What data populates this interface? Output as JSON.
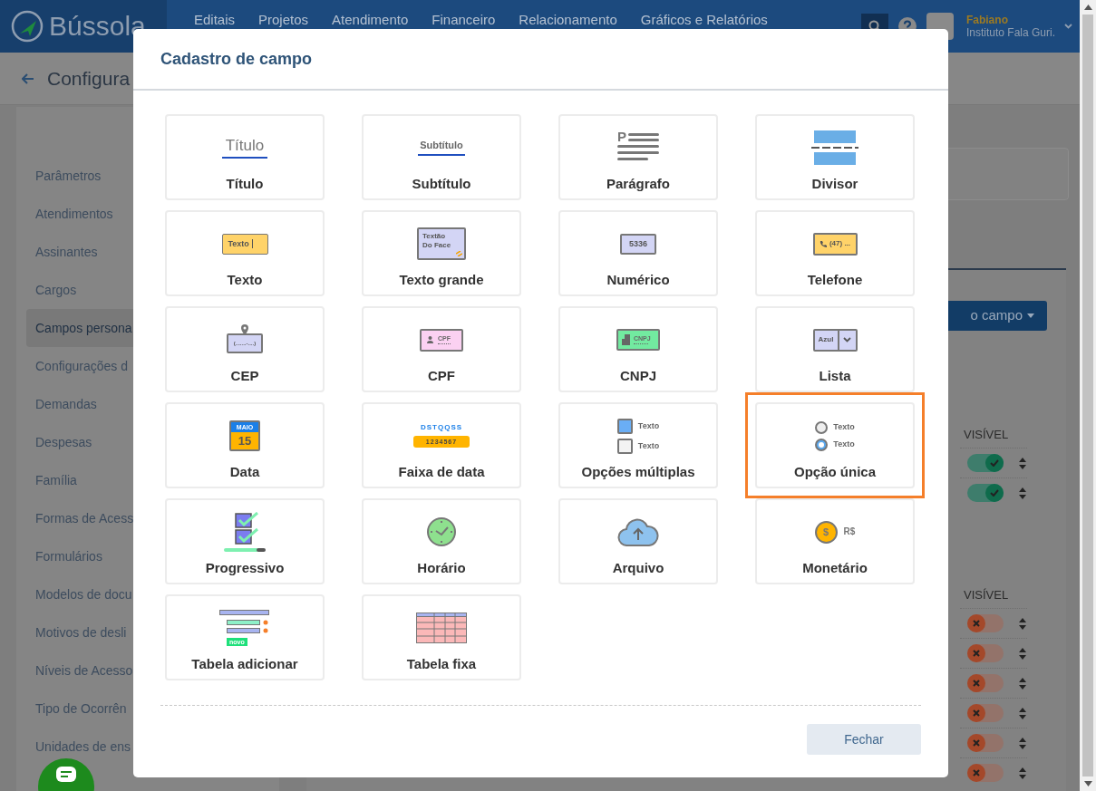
{
  "header": {
    "logo": "Bússola",
    "nav": [
      "Editais",
      "Projetos",
      "Atendimento",
      "Financeiro",
      "Relacionamento",
      "Gráficos e Relatórios"
    ],
    "user_name": "Fabiano",
    "user_org": "Instituto Fala Guri."
  },
  "page_title": "Configura",
  "sidebar": {
    "items": [
      {
        "label": "Parâmetros",
        "selected": false
      },
      {
        "label": "Atendimentos",
        "selected": false
      },
      {
        "label": "Assinantes",
        "selected": false
      },
      {
        "label": "Cargos",
        "selected": false
      },
      {
        "label": "Campos persona",
        "selected": true
      },
      {
        "label": "Configurações d",
        "selected": false
      },
      {
        "label": "Demandas",
        "selected": false
      },
      {
        "label": "Despesas",
        "selected": false
      },
      {
        "label": "Família",
        "selected": false
      },
      {
        "label": "Formas de Acess",
        "selected": false
      },
      {
        "label": "Formulários",
        "selected": false
      },
      {
        "label": "Modelos de docu",
        "selected": false
      },
      {
        "label": "Motivos de desli",
        "selected": false
      },
      {
        "label": "Níveis de Acesso",
        "selected": false
      },
      {
        "label": "Tipo de Ocorrên",
        "selected": false
      },
      {
        "label": "Unidades de ens",
        "selected": false
      }
    ]
  },
  "add_button": "o campo",
  "visible_tables": [
    {
      "header": "VISÍVEL",
      "rows": [
        {
          "on": true
        },
        {
          "on": true
        }
      ]
    },
    {
      "header": "VISÍVEL",
      "rows": [
        {
          "on": false
        },
        {
          "on": false
        },
        {
          "on": false
        },
        {
          "on": false
        },
        {
          "on": false
        },
        {
          "on": false
        }
      ]
    }
  ],
  "modal": {
    "title": "Cadastro de campo",
    "close_button": "Fechar",
    "fields": [
      {
        "kind": "title",
        "label": "Título",
        "icon_texts": [
          "Título"
        ],
        "selected": false
      },
      {
        "kind": "subtitle",
        "label": "Subtítulo",
        "icon_texts": [
          "Subtítulo"
        ],
        "selected": false
      },
      {
        "kind": "paragraph",
        "label": "Parágrafo",
        "icon_texts": [
          "P"
        ],
        "selected": false
      },
      {
        "kind": "divider",
        "label": "Divisor",
        "selected": false
      },
      {
        "kind": "text",
        "label": "Texto",
        "icon_texts": [
          "Texto"
        ],
        "selected": false
      },
      {
        "kind": "textarea",
        "label": "Texto grande",
        "icon_texts": [
          "Textão",
          "Do Face"
        ],
        "selected": false
      },
      {
        "kind": "number",
        "label": "Numérico",
        "icon_texts": [
          "5336"
        ],
        "selected": false
      },
      {
        "kind": "phone",
        "label": "Telefone",
        "icon_texts": [
          "(47) ..."
        ],
        "selected": false
      },
      {
        "kind": "cep",
        "label": "CEP",
        "icon_texts": [
          "(.......-....)"
        ],
        "selected": false
      },
      {
        "kind": "cpf",
        "label": "CPF",
        "icon_texts": [
          "CPF"
        ],
        "selected": false
      },
      {
        "kind": "cnpj",
        "label": "CNPJ",
        "icon_texts": [
          "CNPJ"
        ],
        "selected": false
      },
      {
        "kind": "list",
        "label": "Lista",
        "icon_texts": [
          "Azul"
        ],
        "selected": false
      },
      {
        "kind": "date",
        "label": "Data",
        "icon_texts": [
          "MAIO",
          "15"
        ],
        "selected": false
      },
      {
        "kind": "daterange",
        "label": "Faixa de data",
        "icon_texts": [
          "DSTQQSS",
          "1234567"
        ],
        "selected": false
      },
      {
        "kind": "multi",
        "label": "Opções múltiplas",
        "icon_texts": [
          "Texto",
          "Texto"
        ],
        "selected": false
      },
      {
        "kind": "single",
        "label": "Opção única",
        "icon_texts": [
          "Texto",
          "Texto"
        ],
        "selected": true
      },
      {
        "kind": "progressive",
        "label": "Progressivo",
        "selected": false
      },
      {
        "kind": "time",
        "label": "Horário",
        "selected": false
      },
      {
        "kind": "file",
        "label": "Arquivo",
        "selected": false
      },
      {
        "kind": "money",
        "label": "Monetário",
        "icon_texts": [
          "$",
          "R$"
        ],
        "selected": false
      },
      {
        "kind": "addtable",
        "label": "Tabela adicionar",
        "icon_texts": [
          "novo"
        ],
        "selected": false
      },
      {
        "kind": "fixedtable",
        "label": "Tabela fixa",
        "selected": false
      }
    ]
  }
}
